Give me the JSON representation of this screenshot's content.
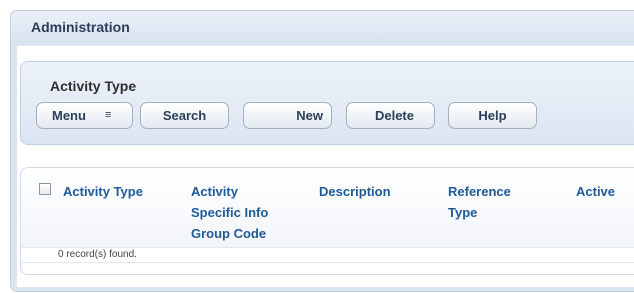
{
  "panel": {
    "title": "Administration"
  },
  "form": {
    "title": "Activity Type",
    "buttons": {
      "menu": "Menu",
      "search": "Search",
      "new": "New",
      "delete": "Delete",
      "help": "Help"
    },
    "menu_icon": "≡"
  },
  "grid": {
    "columns": [
      "Activity Type",
      "Activity\nSpecific Info\nGroup Code",
      "Description",
      "Reference\nType",
      "Active"
    ],
    "status": "0 record(s) found."
  },
  "colors": {
    "header_text": "#1f5a96",
    "title_text": "#2b3f58",
    "panel_bg": "#dbe4f1"
  }
}
